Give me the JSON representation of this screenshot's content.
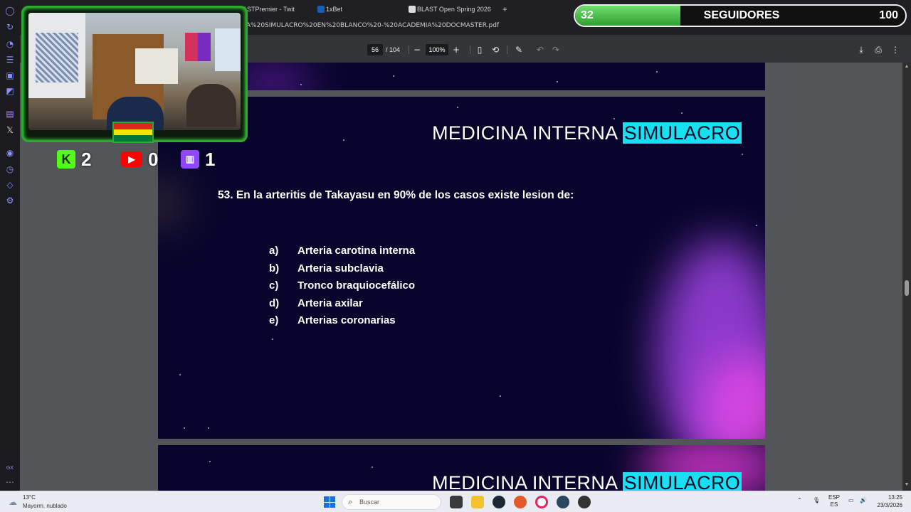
{
  "browser": {
    "tabs": [
      {
        "label": "BLASTPremier - Twit",
        "icon": "twitch-favicon"
      },
      {
        "label": "1xBet",
        "icon": "bet-favicon"
      },
      {
        "label": "BLAST Open Spring 2026",
        "icon": "blast-favicon"
      }
    ],
    "new_tab_label": "+",
    "url_fragment": "RA%20SIMULACRO%20EN%20BLANCO%20-%20ACADEMIA%20DOCMASTER.pdf"
  },
  "pdf_toolbar": {
    "page_current": "56",
    "page_separator": "/",
    "page_total": "104",
    "zoom": "100%",
    "icons": [
      "zoom-out-icon",
      "zoom-in-icon",
      "fit-page-icon",
      "rotate-icon",
      "annotate-icon",
      "undo-icon",
      "redo-icon",
      "download-icon",
      "print-icon",
      "more-icon"
    ]
  },
  "slide": {
    "title_main": "MEDICINA INTERNA",
    "title_highlight": "SIMULACRO",
    "question": "53. En la arteritis de Takayasu en 90% de los casos existe lesion de:",
    "options": [
      {
        "letter": "a)",
        "text": "Arteria carotina interna"
      },
      {
        "letter": "b)",
        "text": "Arteria subclavia"
      },
      {
        "letter": "c)",
        "text": "Tronco braquiocefálico"
      },
      {
        "letter": "d)",
        "text": "Arteria axilar"
      },
      {
        "letter": "e)",
        "text": "Arterias coronarias"
      }
    ],
    "next_title_main": "MEDICINA INTERNA",
    "next_title_highlight": "SIMULACRO",
    "colors": {
      "background": "#07052b",
      "highlight": "#19e0f0",
      "glow": "#c640ff"
    }
  },
  "overlay": {
    "counters": [
      {
        "platform": "kick",
        "icon": "kick-icon",
        "value": "2"
      },
      {
        "platform": "youtube",
        "icon": "youtube-icon",
        "value": "0"
      },
      {
        "platform": "twitch",
        "icon": "twitch-icon",
        "value": "1"
      }
    ],
    "followers": {
      "current": "32",
      "label": "SEGUIDORES",
      "goal": "100",
      "progress": 0.32
    },
    "flag": "bolivia-flag"
  },
  "taskbar": {
    "weather_temp": "13°C",
    "weather_desc": "Mayorm. nublado",
    "search_placeholder": "Buscar",
    "lang_top": "ESP",
    "lang_bottom": "ES",
    "time": "13:25",
    "date": "23/3/2026"
  }
}
